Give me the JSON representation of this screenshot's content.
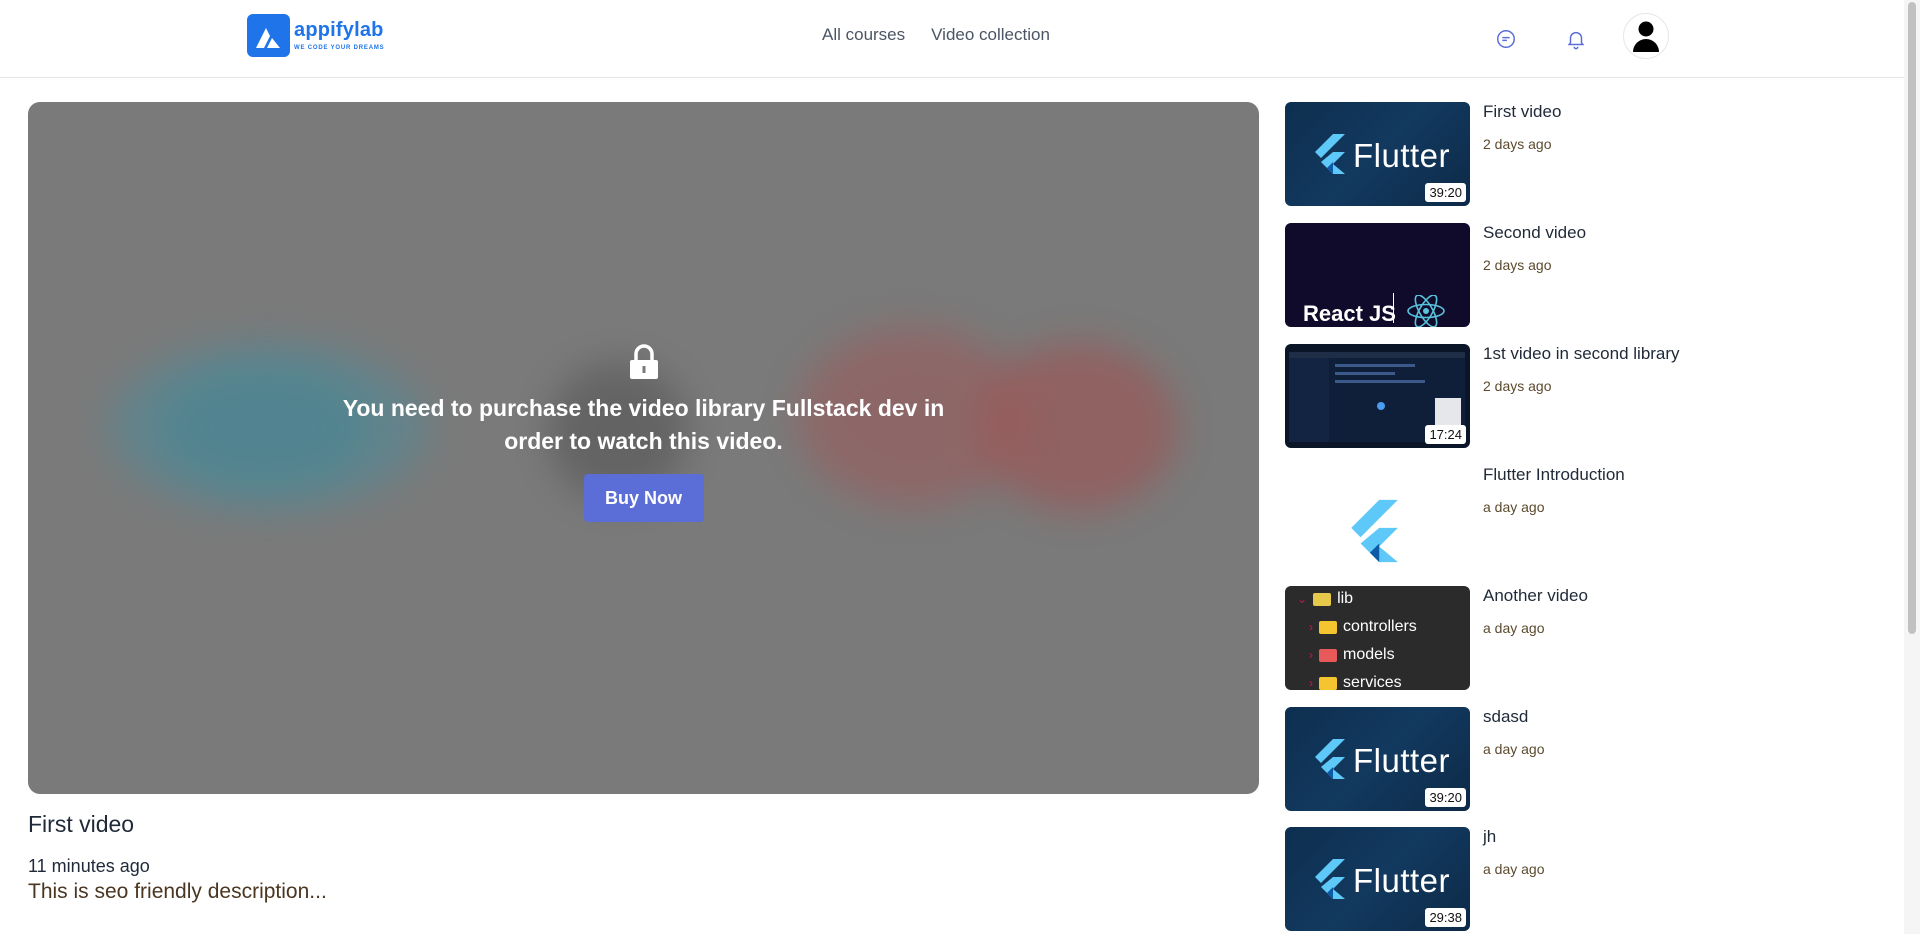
{
  "header": {
    "logo": {
      "name": "appifylab",
      "tagline": "WE CODE YOUR DREAMS"
    },
    "nav": [
      {
        "label": "All courses"
      },
      {
        "label": "Video collection"
      }
    ]
  },
  "player": {
    "lock_message_pre": "You need to purchase the video library ",
    "library_name": "Fullstack dev",
    "lock_message_post": " in order to watch this video.",
    "buy_label": "Buy Now"
  },
  "video": {
    "title": "First video",
    "time": "11 minutes ago",
    "description": "This is seo friendly description..."
  },
  "playlist": [
    {
      "title": "First video",
      "date": "2 days ago",
      "duration": "39:20",
      "thumb": "flutter",
      "thumb_text": "Flutter"
    },
    {
      "title": "Second video",
      "date": "2 days ago",
      "duration": "",
      "thumb": "react",
      "thumb_text": "React JS"
    },
    {
      "title": "1st video in second library",
      "date": "2 days ago",
      "duration": "17:24",
      "thumb": "code",
      "thumb_text": ""
    },
    {
      "title": "Flutter Introduction",
      "date": "a day ago",
      "duration": "",
      "thumb": "flutter-logo",
      "thumb_text": ""
    },
    {
      "title": "Another video",
      "date": "a day ago",
      "duration": "",
      "thumb": "folder-tree",
      "thumb_text": "",
      "tree": [
        "lib",
        "controllers",
        "models",
        "services"
      ]
    },
    {
      "title": "sdasd",
      "date": "a day ago",
      "duration": "39:20",
      "thumb": "flutter",
      "thumb_text": "Flutter"
    },
    {
      "title": "jh",
      "date": "a day ago",
      "duration": "29:38",
      "thumb": "flutter",
      "thumb_text": "Flutter"
    }
  ],
  "icons": {
    "chat": "chat-icon",
    "bell": "bell-icon",
    "avatar": "user-avatar-icon",
    "lock": "lock-icon"
  },
  "colors": {
    "brand": "#1e74e8",
    "buy_button": "#5b6dd6",
    "player_bg": "#7a7a7a"
  }
}
